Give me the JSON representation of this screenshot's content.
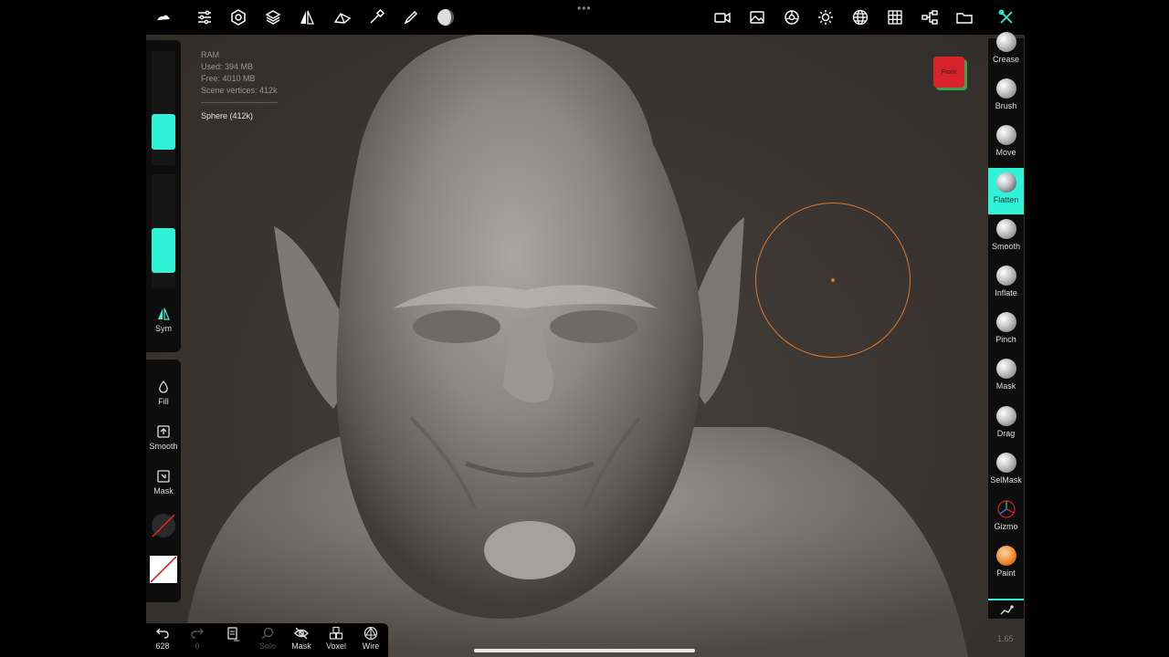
{
  "top_toolbar": {
    "left_icons": [
      "cloud-icon",
      "settings-sliders-icon",
      "gear-icon",
      "layers-icon",
      "symmetry-icon",
      "topology-icon",
      "eyedropper-icon",
      "pen-icon",
      "matcap-icon"
    ],
    "right_icons": [
      "camera-icon",
      "image-icon",
      "shading-icon",
      "light-icon",
      "grid-sphere-icon",
      "grid-icon",
      "scene-tree-icon",
      "folder-icon",
      "tools-icon"
    ]
  },
  "stats": {
    "title": "RAM",
    "used": "Used: 394 MB",
    "free": "Free: 4010 MB",
    "vertices": "Scene vertices: 412k",
    "separator": "----------------------------",
    "selected": "Sphere (412k)"
  },
  "view_cube": {
    "label": "Front",
    "front_color": "#d9232b",
    "side_color": "#3fa24a"
  },
  "left_panel": {
    "radius_slider_value": 0.31,
    "intensity_slider_value": 0.39,
    "sym_label": "Sym",
    "tools": [
      {
        "label": "Fill",
        "icon": "drop-icon"
      },
      {
        "label": "Smooth",
        "icon": "upload-square-icon"
      },
      {
        "label": "Mask",
        "icon": "mask-square-icon"
      }
    ],
    "accent": "#2ff2d6"
  },
  "right_panel": {
    "tools": [
      {
        "label": "Crease"
      },
      {
        "label": "Brush"
      },
      {
        "label": "Move"
      },
      {
        "label": "Flatten"
      },
      {
        "label": "Smooth"
      },
      {
        "label": "Inflate"
      },
      {
        "label": "Pinch"
      },
      {
        "label": "Mask"
      },
      {
        "label": "Drag"
      },
      {
        "label": "SelMask"
      },
      {
        "label": "Gizmo"
      },
      {
        "label": "Paint"
      }
    ],
    "active": "Flatten",
    "version": "1.65"
  },
  "bottom_bar": {
    "undo_count": "628",
    "redo_count": "0",
    "solo_label": "Solo",
    "mask_label": "Mask",
    "voxel_label": "Voxel",
    "wire_label": "Wire"
  },
  "brush_cursor_color": "#d9782a"
}
